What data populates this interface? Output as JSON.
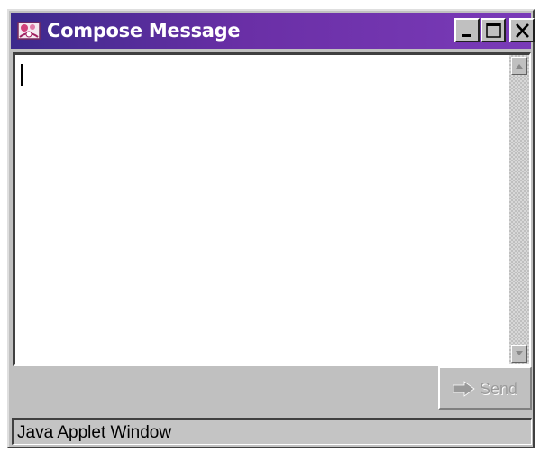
{
  "window": {
    "title": "Compose Message"
  },
  "titlebar_buttons": {
    "minimize_icon": "minimize-icon",
    "maximize_icon": "maximize-icon",
    "close_icon": "close-icon"
  },
  "compose": {
    "message_value": ""
  },
  "toolbar": {
    "send_label": "Send",
    "send_icon": "arrow-right-icon"
  },
  "status": {
    "text": "Java Applet Window"
  },
  "colors": {
    "title_bar_start": "#3c2a8c",
    "title_bar_end": "#7a3bb8",
    "face": "#c0c0c0",
    "disabled_text": "#9a9a9a"
  }
}
